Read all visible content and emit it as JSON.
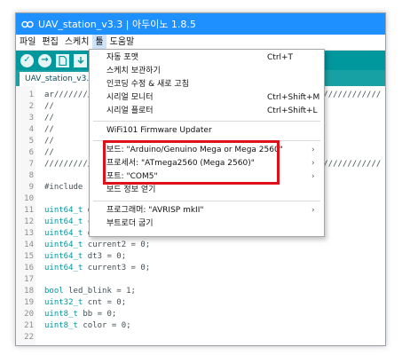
{
  "window": {
    "title": "UAV_station_v3.3 | 아두이노 1.8.5"
  },
  "menubar": {
    "items": [
      "파일",
      "편집",
      "스케치",
      "툴",
      "도움말"
    ]
  },
  "tab": {
    "label": "UAV_station_v3..."
  },
  "editor": {
    "lines": [
      {
        "n": "1",
        "code": "ar////////////////////////////////////////////////////////////////////"
      },
      {
        "n": "2",
        "code": "//"
      },
      {
        "n": "3",
        "code": "//"
      },
      {
        "n": "4",
        "code": "//"
      },
      {
        "n": "5",
        "code": "//"
      },
      {
        "n": "6",
        "code": "//"
      },
      {
        "n": "7",
        "code": "//////////////////////////////////////////////////////////////////////"
      },
      {
        "n": "8",
        "code": ""
      },
      {
        "n": "9",
        "code": "#include \"my"
      },
      {
        "n": "10",
        "code": ""
      },
      {
        "n": "11",
        "type": "uint64_t",
        "rest": " dt"
      },
      {
        "n": "12",
        "type": "uint64_t",
        "rest": " cur"
      },
      {
        "n": "13",
        "type": "uint64_t",
        "rest": " dt2 = 0;"
      },
      {
        "n": "14",
        "type": "uint64_t",
        "rest": " current2 = 0;"
      },
      {
        "n": "15",
        "type": "uint64_t",
        "rest": " dt3 = 0;"
      },
      {
        "n": "16",
        "type": "uint64_t",
        "rest": " current3 = 0;"
      },
      {
        "n": "17",
        "code": ""
      },
      {
        "n": "18",
        "type": "bool",
        "rest": " led_blink = 1;"
      },
      {
        "n": "19",
        "type": "uint32_t",
        "rest": " cnt = 0;"
      },
      {
        "n": "20",
        "type": "uint8_t",
        "rest": " bb = 0;"
      },
      {
        "n": "21",
        "type": "uint8_t",
        "rest": " color = 0;"
      },
      {
        "n": "22",
        "code": ""
      }
    ]
  },
  "tools_menu": {
    "auto_format": {
      "label": "자동 포맷",
      "shortcut": "Ctrl+T"
    },
    "archive_sketch": {
      "label": "스케치 보관하기"
    },
    "fix_encoding": {
      "label": "인코딩 수정 & 새로 고침"
    },
    "serial_monitor": {
      "label": "시리얼 모니터",
      "shortcut": "Ctrl+Shift+M"
    },
    "serial_plotter": {
      "label": "시리얼 플로터",
      "shortcut": "Ctrl+Shift+L"
    },
    "wifi_updater": {
      "label": "WiFi101 Firmware Updater"
    },
    "board": {
      "label": "보드: \"Arduino/Genuino Mega or Mega 2560\"",
      "arrow": "›"
    },
    "processor": {
      "label": "프로세서: \"ATmega2560 (Mega 2560)\"",
      "arrow": "›"
    },
    "port": {
      "label": "포트: \"COM5\"",
      "arrow": "›"
    },
    "board_info": {
      "label": "보드 정보 얻기"
    },
    "programmer": {
      "label": "프로그래머: \"AVRISP mkII\"",
      "arrow": "›"
    },
    "burn_bootloader": {
      "label": "부트로더 굽기"
    }
  },
  "colors": {
    "titlebar": "#1e90ff",
    "toolbar": "#00979d",
    "highlight": "#e0101a"
  },
  "icons": [
    "arduino-logo-icon",
    "verify-icon",
    "upload-icon",
    "new-file-icon",
    "open-icon"
  ]
}
